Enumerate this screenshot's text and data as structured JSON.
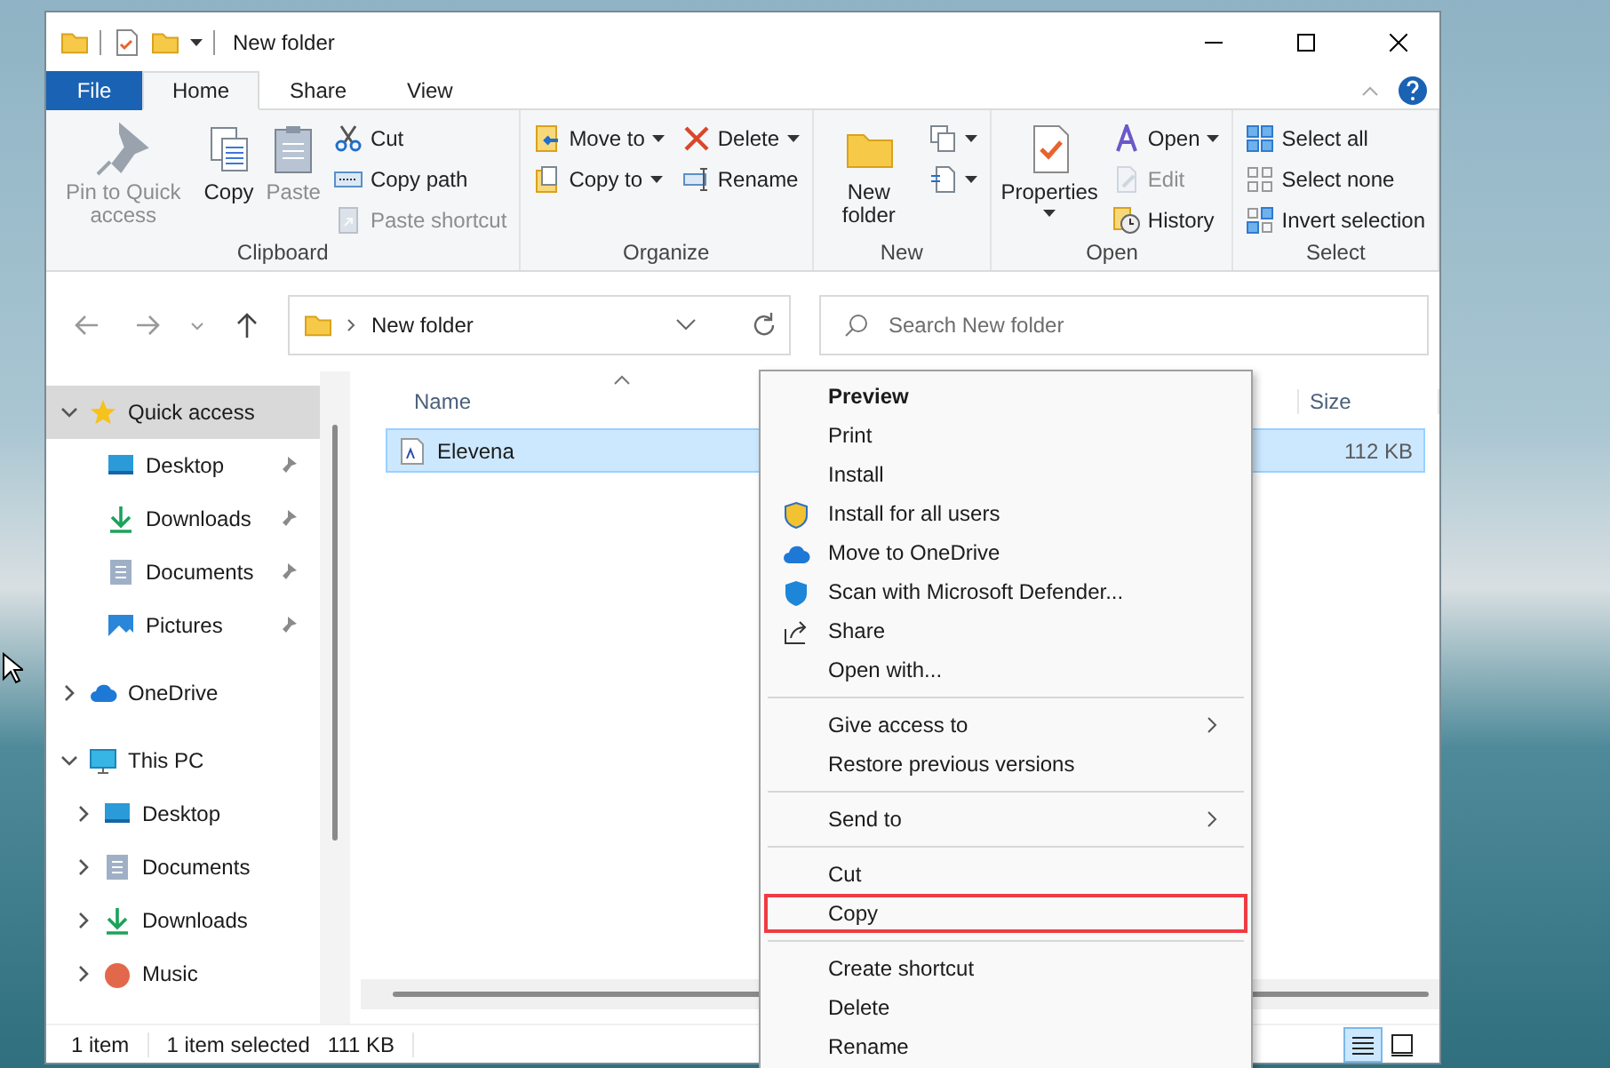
{
  "window": {
    "title": "New folder"
  },
  "ribbon_tabs": [
    {
      "label": "File",
      "kind": "file",
      "selected": false
    },
    {
      "label": "Home",
      "kind": "tab",
      "selected": true
    },
    {
      "label": "Share",
      "kind": "tab",
      "selected": false
    },
    {
      "label": "View",
      "kind": "tab",
      "selected": false
    }
  ],
  "ribbon": {
    "groups": [
      {
        "label": "Clipboard",
        "columns": [
          {
            "kind": "large",
            "items": [
              {
                "label": "Pin to Quick access",
                "disabled": true,
                "dropdown": false
              }
            ]
          },
          {
            "kind": "large",
            "items": [
              {
                "label": "Copy",
                "disabled": false,
                "dropdown": false
              }
            ]
          },
          {
            "kind": "large",
            "items": [
              {
                "label": "Paste",
                "disabled": true,
                "dropdown": false
              }
            ]
          },
          {
            "kind": "small",
            "items": [
              {
                "label": "Cut",
                "disabled": false,
                "dropdown": false
              },
              {
                "label": "Copy path",
                "disabled": false,
                "dropdown": false
              },
              {
                "label": "Paste shortcut",
                "disabled": true,
                "dropdown": false
              }
            ]
          }
        ]
      },
      {
        "label": "Organize",
        "columns": [
          {
            "kind": "small",
            "items": [
              {
                "label": "Move to",
                "disabled": false,
                "dropdown": true
              },
              {
                "label": "Copy to",
                "disabled": false,
                "dropdown": true
              }
            ]
          },
          {
            "kind": "small",
            "items": [
              {
                "label": "Delete",
                "disabled": false,
                "dropdown": true
              },
              {
                "label": "Rename",
                "disabled": false,
                "dropdown": false
              }
            ]
          }
        ]
      },
      {
        "label": "New",
        "columns": [
          {
            "kind": "large",
            "items": [
              {
                "label": "New folder",
                "disabled": false,
                "dropdown": false
              }
            ]
          },
          {
            "kind": "small",
            "items": [
              {
                "disabled": false,
                "dropdown": true
              },
              {
                "disabled": false,
                "dropdown": true
              }
            ]
          }
        ]
      },
      {
        "label": "Open",
        "columns": [
          {
            "kind": "large",
            "items": [
              {
                "label": "Properties",
                "disabled": false,
                "dropdown": true
              }
            ]
          },
          {
            "kind": "small",
            "items": [
              {
                "label": "Open",
                "disabled": false,
                "dropdown": true
              },
              {
                "label": "Edit",
                "disabled": true,
                "dropdown": false
              },
              {
                "label": "History",
                "disabled": false,
                "dropdown": false
              }
            ]
          }
        ]
      },
      {
        "label": "Select",
        "columns": [
          {
            "kind": "small",
            "items": [
              {
                "label": "Select all",
                "disabled": false,
                "dropdown": false
              },
              {
                "label": "Select none",
                "disabled": false,
                "dropdown": false
              },
              {
                "label": "Invert selection",
                "disabled": false,
                "dropdown": false
              }
            ]
          }
        ]
      }
    ]
  },
  "address_bar": {
    "path": "New folder"
  },
  "search": {
    "placeholder": "Search New folder"
  },
  "navigation": [
    {
      "label": "Quick access",
      "selected": true,
      "expanded": true,
      "children": [
        {
          "label": "Desktop",
          "pinned": true,
          "selected": false
        },
        {
          "label": "Downloads",
          "pinned": true,
          "selected": false
        },
        {
          "label": "Documents",
          "pinned": true,
          "selected": false
        },
        {
          "label": "Pictures",
          "pinned": true,
          "selected": false
        }
      ]
    },
    {
      "label": "OneDrive",
      "selected": false,
      "expanded": false
    },
    {
      "label": "This PC",
      "selected": false,
      "expanded": true,
      "children": [
        {
          "label": "Desktop",
          "pinned": false,
          "selected": false,
          "expanded": false
        },
        {
          "label": "Documents",
          "pinned": false,
          "selected": false,
          "expanded": false
        },
        {
          "label": "Downloads",
          "pinned": false,
          "selected": false,
          "expanded": false
        },
        {
          "label": "Music",
          "pinned": false,
          "selected": false,
          "expanded": false
        }
      ]
    }
  ],
  "file_list": {
    "columns": [
      "Name",
      "Size"
    ],
    "rows": [
      {
        "name": "Elevena",
        "size": "112 KB",
        "selected": true
      }
    ]
  },
  "context_menu": {
    "sections": [
      [
        {
          "label": "Preview",
          "bold": true,
          "submenu": false,
          "selected": false
        },
        {
          "label": "Print",
          "bold": false,
          "submenu": false,
          "selected": false
        },
        {
          "label": "Install",
          "bold": false,
          "submenu": false,
          "selected": false
        },
        {
          "label": "Install for all users",
          "bold": false,
          "submenu": false,
          "selected": false
        },
        {
          "label": "Move to OneDrive",
          "bold": false,
          "submenu": false,
          "selected": false
        },
        {
          "label": "Scan with Microsoft Defender...",
          "bold": false,
          "submenu": false,
          "selected": false
        },
        {
          "label": "Share",
          "bold": false,
          "submenu": false,
          "selected": false
        },
        {
          "label": "Open with...",
          "bold": false,
          "submenu": false,
          "selected": false
        }
      ],
      [
        {
          "label": "Give access to",
          "bold": false,
          "submenu": true,
          "selected": false
        },
        {
          "label": "Restore previous versions",
          "bold": false,
          "submenu": false,
          "selected": false
        }
      ],
      [
        {
          "label": "Send to",
          "bold": false,
          "submenu": true,
          "selected": false
        }
      ],
      [
        {
          "label": "Cut",
          "bold": false,
          "submenu": false,
          "selected": false
        },
        {
          "label": "Copy",
          "bold": false,
          "submenu": false,
          "selected": true
        }
      ],
      [
        {
          "label": "Create shortcut",
          "bold": false,
          "submenu": false,
          "selected": false
        },
        {
          "label": "Delete",
          "bold": false,
          "submenu": false,
          "selected": false
        },
        {
          "label": "Rename",
          "bold": false,
          "submenu": false,
          "selected": false
        }
      ]
    ]
  },
  "status_bar": {
    "item_count": "1 item",
    "selection": "1 item selected",
    "selection_size": "111 KB",
    "views": [
      {
        "kind": "details",
        "selected": true
      },
      {
        "kind": "large-icons",
        "selected": false
      }
    ]
  }
}
